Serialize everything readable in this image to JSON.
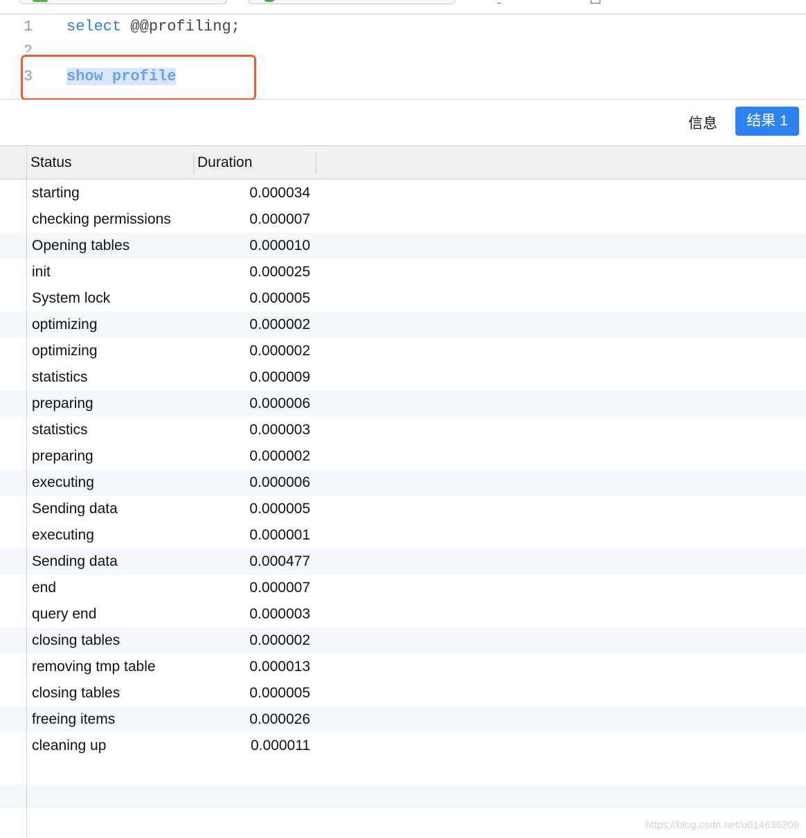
{
  "editor": {
    "lines": [
      {
        "number": "1",
        "keyword": "select",
        "rest": " @@profiling;"
      },
      {
        "number": "2"
      },
      {
        "number": "3",
        "selected": "show profile"
      }
    ]
  },
  "result_tabs": {
    "info_label": "信息",
    "result_label": "结果 1"
  },
  "table": {
    "columns": [
      "Status",
      "Duration"
    ],
    "rows": [
      {
        "status": "starting",
        "duration": "0.000034"
      },
      {
        "status": "checking permissions",
        "duration": "0.000007"
      },
      {
        "status": "Opening tables",
        "duration": "0.000010"
      },
      {
        "status": "init",
        "duration": "0.000025"
      },
      {
        "status": "System lock",
        "duration": "0.000005"
      },
      {
        "status": "optimizing",
        "duration": "0.000002"
      },
      {
        "status": "optimizing",
        "duration": "0.000002"
      },
      {
        "status": "statistics",
        "duration": "0.000009"
      },
      {
        "status": "preparing",
        "duration": "0.000006"
      },
      {
        "status": "statistics",
        "duration": "0.000003"
      },
      {
        "status": "preparing",
        "duration": "0.000002"
      },
      {
        "status": "executing",
        "duration": "0.000006"
      },
      {
        "status": "Sending data",
        "duration": "0.000005"
      },
      {
        "status": "executing",
        "duration": "0.000001"
      },
      {
        "status": "Sending data",
        "duration": "0.000477"
      },
      {
        "status": "end",
        "duration": "0.000007"
      },
      {
        "status": "query end",
        "duration": "0.000003"
      },
      {
        "status": "closing tables",
        "duration": "0.000002"
      },
      {
        "status": "removing tmp table",
        "duration": "0.000013"
      },
      {
        "status": "closing tables",
        "duration": "0.000005"
      },
      {
        "status": "freeing items",
        "duration": "0.000026"
      },
      {
        "status": "cleaning up",
        "duration": "0.000011"
      }
    ]
  },
  "watermark": "https://blog.csdn.net/u014636209",
  "colors": {
    "accent": "#2e82f0",
    "highlight_box": "#ec5a30",
    "keyword": "#2a7de8",
    "row_stripe": "#f4f7fc"
  }
}
